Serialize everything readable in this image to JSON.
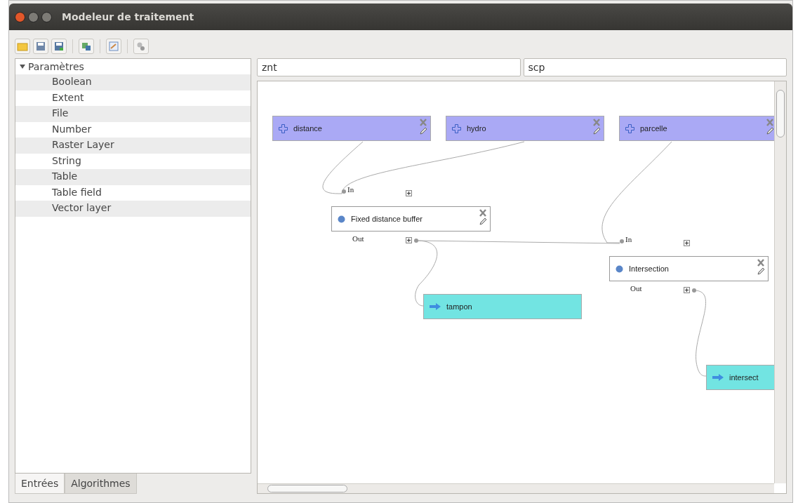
{
  "window": {
    "title": "Modeleur de traitement"
  },
  "toolbar": {
    "buttons": [
      {
        "kind": "open"
      },
      {
        "kind": "save"
      },
      {
        "kind": "save-as"
      },
      {
        "kind": "export"
      },
      {
        "kind": "edit-help"
      },
      {
        "kind": "run"
      }
    ]
  },
  "inputs_panel": {
    "header": {
      "label": "Paramètres",
      "expanded": true
    },
    "items": [
      "Boolean",
      "Extent",
      "File",
      "Number",
      "Raster Layer",
      "String",
      "Table",
      "Table field",
      "Vector layer"
    ]
  },
  "tabs": [
    {
      "label": "Entrées",
      "selected": true
    },
    {
      "label": "Algorithmes",
      "selected": false
    }
  ],
  "model_fields": [
    {
      "value": "znt"
    },
    {
      "value": "scp"
    }
  ],
  "canvas": {
    "nodes": [
      {
        "kind": "input",
        "label": "distance"
      },
      {
        "kind": "input",
        "label": "hydro"
      },
      {
        "kind": "input",
        "label": "parcelle"
      },
      {
        "kind": "algorithm",
        "label": "Fixed distance buffer",
        "in_label": "In",
        "out_label": "Out"
      },
      {
        "kind": "algorithm",
        "label": "Intersection",
        "in_label": "In",
        "out_label": "Out"
      },
      {
        "kind": "output",
        "label": "tampon"
      },
      {
        "kind": "output",
        "label": "intersect"
      }
    ]
  }
}
